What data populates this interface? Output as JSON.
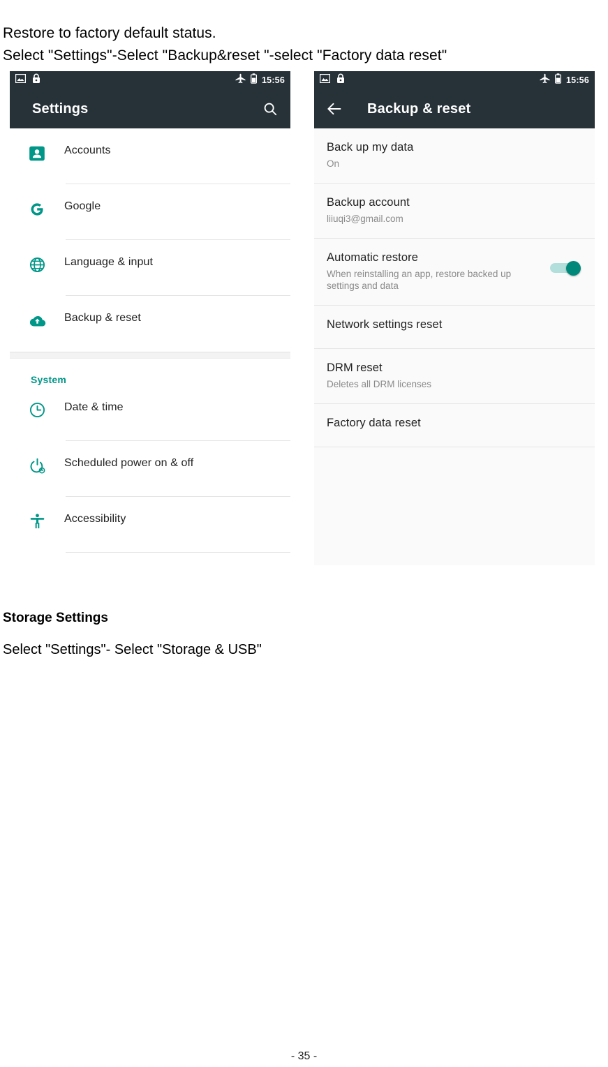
{
  "document": {
    "intro_line_1": "Restore to factory default status.",
    "intro_line_2": "Select \"Settings\"-Select \"Backup&reset \"-select \"Factory data reset\"",
    "storage_heading": "Storage Settings",
    "storage_line": "Select \"Settings\"- Select \"Storage & USB\"",
    "page_number": "- 35 -"
  },
  "colors": {
    "accent_teal": "#009688",
    "toggle_on": "#00897b",
    "toggle_track": "#b2dfdb",
    "appbar": "#263238",
    "panel_right_bg": "#fafafa"
  },
  "status_bar": {
    "time": "15:56",
    "icons": [
      "screenshot-icon",
      "lock-icon",
      "airplane-mode-icon",
      "battery-icon"
    ]
  },
  "settings_screen": {
    "title": "Settings",
    "search_icon": "search-icon",
    "items": [
      {
        "label": "Accounts",
        "icon": "accounts-icon"
      },
      {
        "label": "Google",
        "icon": "google-g-icon"
      },
      {
        "label": "Language & input",
        "icon": "globe-icon"
      },
      {
        "label": "Backup & reset",
        "icon": "cloud-upload-icon"
      }
    ],
    "section_title": "System",
    "system_items": [
      {
        "label": "Date & time",
        "icon": "clock-icon"
      },
      {
        "label": "Scheduled power on & off",
        "icon": "power-clock-icon"
      },
      {
        "label": "Accessibility",
        "icon": "accessibility-icon"
      }
    ]
  },
  "backup_screen": {
    "title": "Backup & reset",
    "back_icon": "back-arrow-icon",
    "items": [
      {
        "title": "Back up my data",
        "subtitle": "On",
        "toggle": null
      },
      {
        "title": "Backup account",
        "subtitle": "liiuqi3@gmail.com",
        "toggle": null
      },
      {
        "title": "Automatic restore",
        "subtitle": "When reinstalling an app, restore backed up settings and data",
        "toggle": "on"
      },
      {
        "title": "Network settings reset",
        "subtitle": "",
        "toggle": null
      },
      {
        "title": "DRM reset",
        "subtitle": "Deletes all DRM licenses",
        "toggle": null
      },
      {
        "title": "Factory data reset",
        "subtitle": "",
        "toggle": null
      }
    ]
  }
}
